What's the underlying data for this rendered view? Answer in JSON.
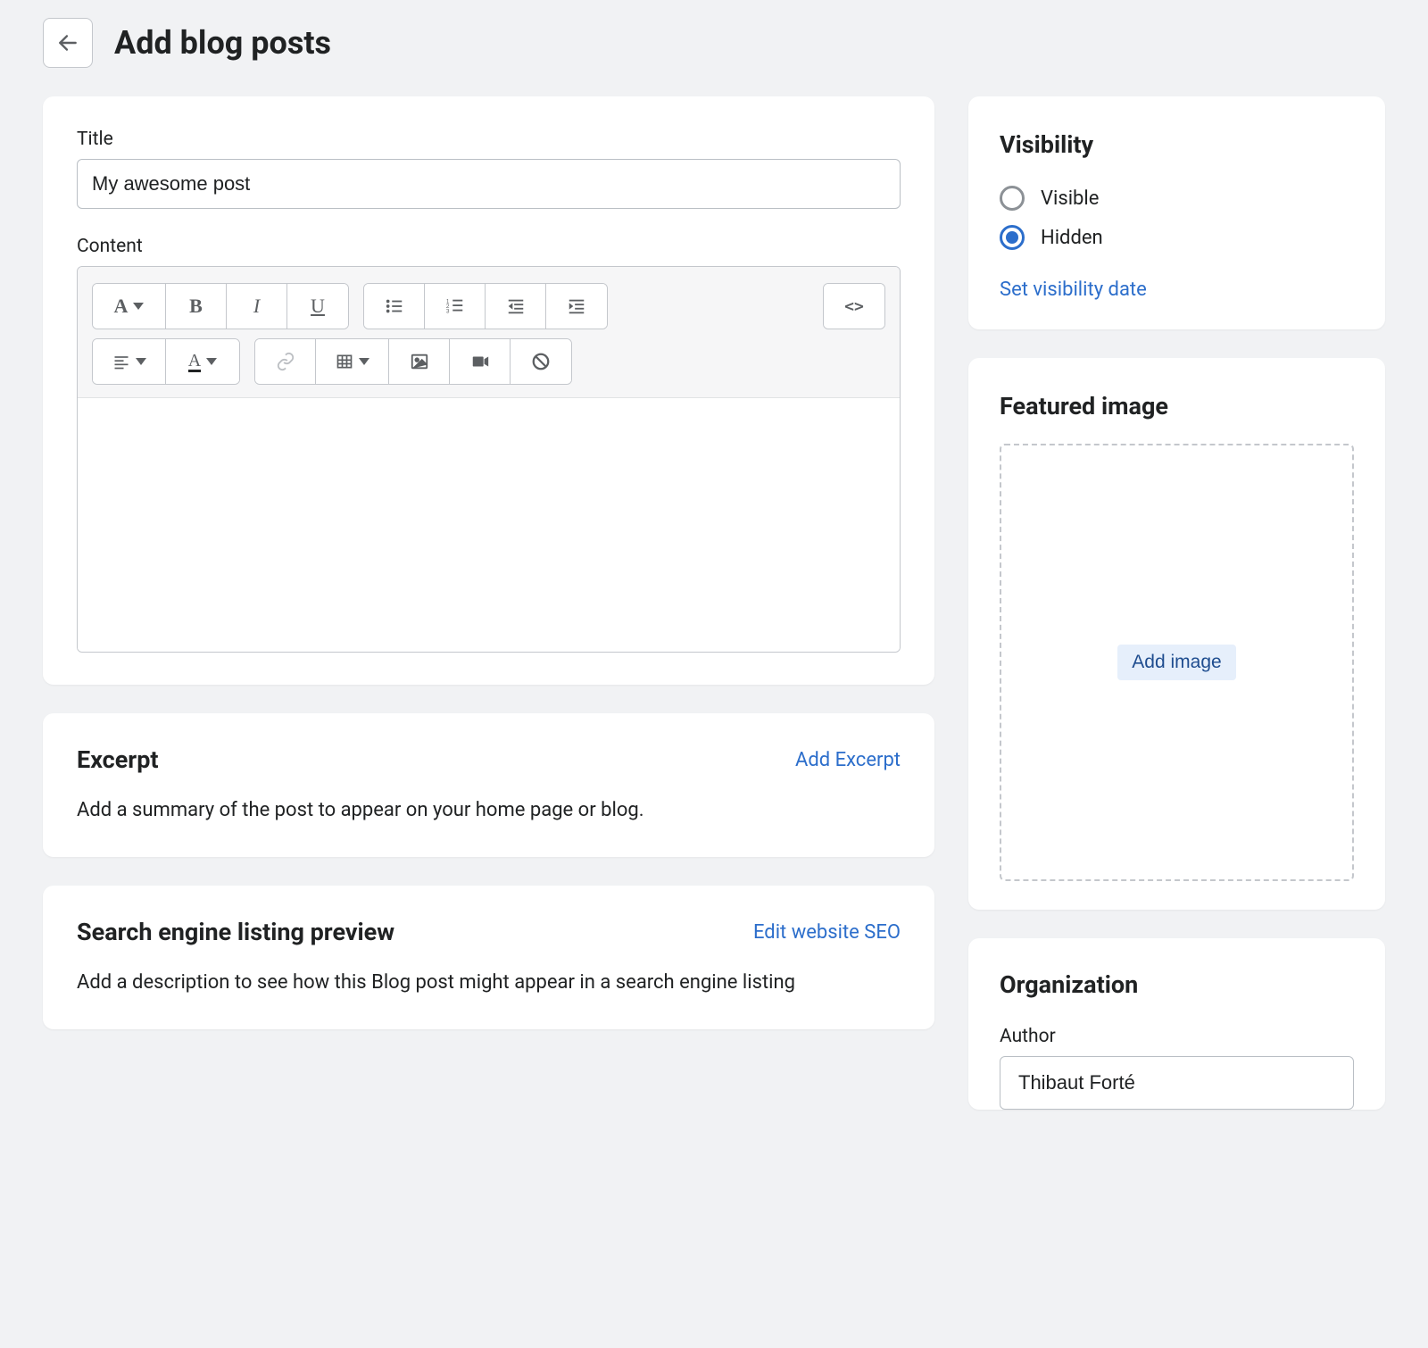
{
  "header": {
    "title": "Add blog posts"
  },
  "titleCard": {
    "titleLabel": "Title",
    "titleValue": "My awesome post",
    "contentLabel": "Content"
  },
  "excerpt": {
    "heading": "Excerpt",
    "action": "Add Excerpt",
    "body": "Add a summary of the post to appear on your home page or blog."
  },
  "seo": {
    "heading": "Search engine listing preview",
    "action": "Edit website SEO",
    "body": "Add a description to see how this Blog post might appear in a search engine listing"
  },
  "visibility": {
    "heading": "Visibility",
    "options": {
      "visible": "Visible",
      "hidden": "Hidden"
    },
    "selected": "hidden",
    "dateLink": "Set visibility date"
  },
  "featured": {
    "heading": "Featured image",
    "addLabel": "Add image"
  },
  "organization": {
    "heading": "Organization",
    "authorLabel": "Author",
    "authorValue": "Thibaut Forté"
  }
}
